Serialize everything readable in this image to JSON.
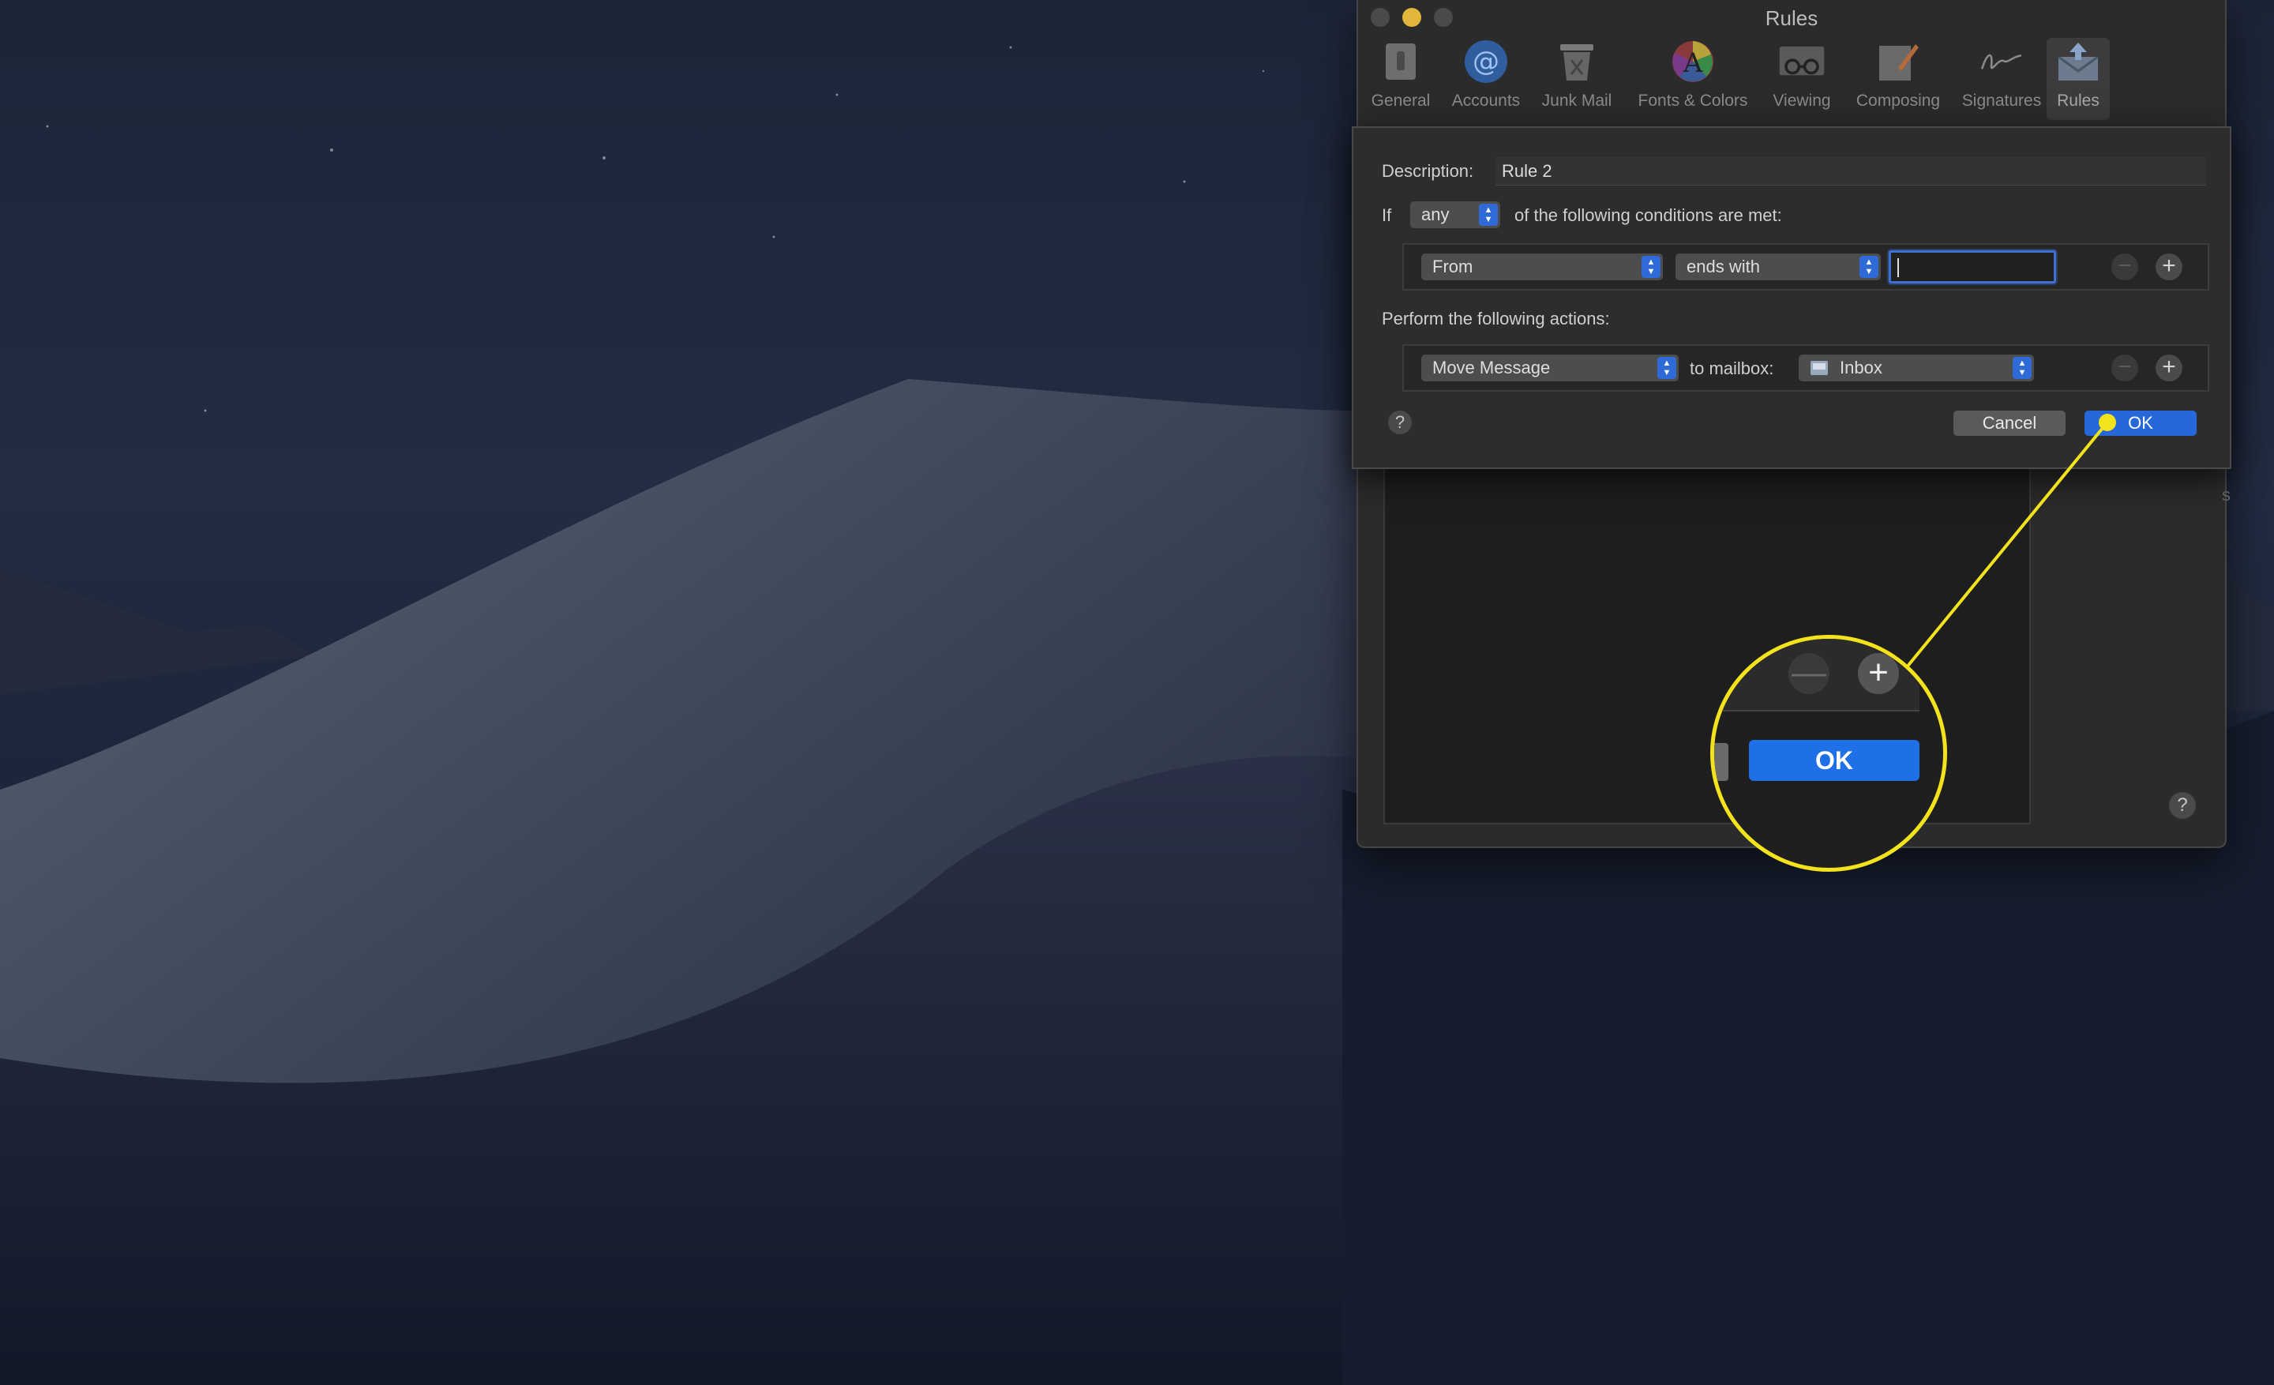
{
  "window": {
    "title": "Rules",
    "toolbar": [
      {
        "label": "General",
        "icon": "general-switch-icon"
      },
      {
        "label": "Accounts",
        "icon": "at-sign-icon"
      },
      {
        "label": "Junk Mail",
        "icon": "trash-can-icon"
      },
      {
        "label": "Fonts & Colors",
        "icon": "color-wheel-icon"
      },
      {
        "label": "Viewing",
        "icon": "glasses-icon"
      },
      {
        "label": "Composing",
        "icon": "pencil-icon"
      },
      {
        "label": "Signatures",
        "icon": "signature-icon"
      },
      {
        "label": "Rules",
        "icon": "envelope-arrow-icon"
      }
    ],
    "active_tab": "Rules"
  },
  "sheet": {
    "description_label": "Description:",
    "description_value": "Rule 2",
    "if_label": "If",
    "if_mode": "any",
    "conditions_suffix": "of the following conditions are met:",
    "condition": {
      "field": "From",
      "operator": "ends with",
      "value": ""
    },
    "actions_label": "Perform the following actions:",
    "action": {
      "type": "Move Message",
      "to_label": "to mailbox:",
      "mailbox": "Inbox"
    },
    "help": "?",
    "cancel_label": "Cancel",
    "ok_label": "OK"
  },
  "zoom": {
    "ok_label": "OK",
    "minus": "—",
    "plus": "+"
  },
  "colors": {
    "accent_blue": "#2768d8",
    "callout_yellow": "#f2e31c",
    "traffic_minimize": "#e2b63a"
  }
}
